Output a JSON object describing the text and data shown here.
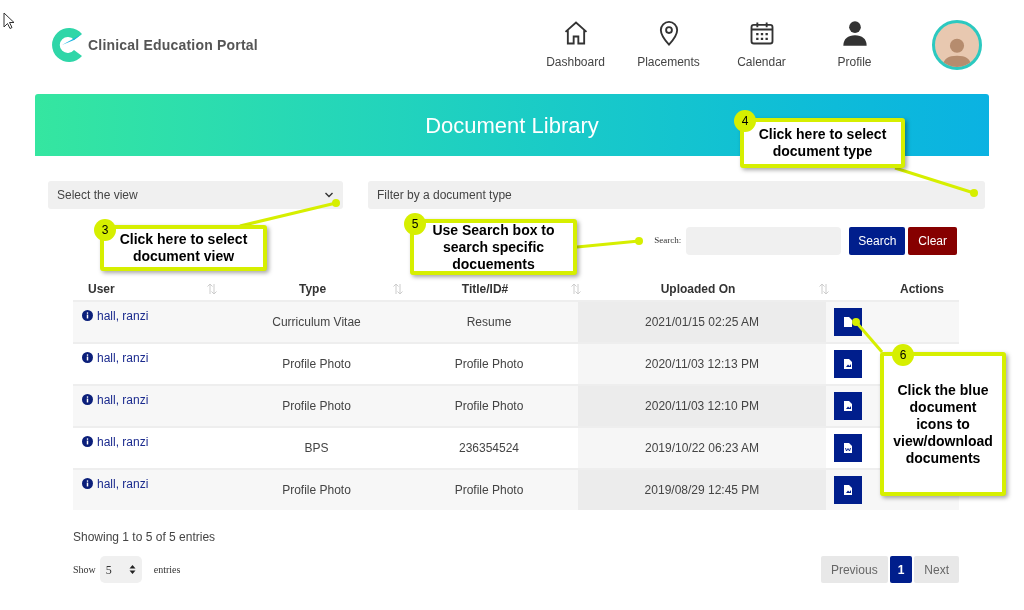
{
  "header": {
    "brand": "Clinical Education Portal",
    "nav": [
      {
        "label": "Dashboard",
        "kind": "home"
      },
      {
        "label": "Placements",
        "kind": "pin"
      },
      {
        "label": "Calendar",
        "kind": "calendar"
      },
      {
        "label": "Profile",
        "kind": "person"
      }
    ]
  },
  "banner": {
    "title": "Document Library"
  },
  "filters": {
    "view_select": {
      "placeholder": "Select the view"
    },
    "type_select": {
      "placeholder": "Filter by a document type"
    }
  },
  "search": {
    "label": "Search:",
    "buttons": [
      "Search",
      "Clear"
    ]
  },
  "table": {
    "columns": [
      {
        "label": "User",
        "sortable": true
      },
      {
        "label": "Type",
        "sortable": true
      },
      {
        "label": "Title/ID#",
        "sortable": true
      },
      {
        "label": "Uploaded On",
        "sortable": true
      },
      {
        "label": "Actions",
        "sortable": false
      }
    ],
    "rows": [
      {
        "user": "hall, ranzi",
        "type": "Curriculum Vitae",
        "title": "Resume",
        "uploaded": "2021/01/15 02:25 AM",
        "kind": "file"
      },
      {
        "user": "hall, ranzi",
        "type": "Profile Photo",
        "title": "Profile Photo",
        "uploaded": "2020/11/03 12:13 PM",
        "kind": "image"
      },
      {
        "user": "hall, ranzi",
        "type": "Profile Photo",
        "title": "Profile Photo",
        "uploaded": "2020/11/03 12:10 PM",
        "kind": "image"
      },
      {
        "user": "hall, ranzi",
        "type": "BPS",
        "title": "236354524",
        "uploaded": "2019/10/22 06:23 AM",
        "kind": "word"
      },
      {
        "user": "hall, ranzi",
        "type": "Profile Photo",
        "title": "Profile Photo",
        "uploaded": "2019/08/29 12:45 PM",
        "kind": "image"
      }
    ]
  },
  "footer": {
    "info": "Showing 1 to 5 of 5 entries",
    "show_label": "Show",
    "page_size": "5",
    "entries_label": "entries",
    "pagination": [
      {
        "label": "Previous",
        "selected": false
      },
      {
        "label": "1",
        "selected": true
      },
      {
        "label": "Next",
        "selected": false
      }
    ]
  },
  "callouts": [
    {
      "number": "3",
      "text": "Click here to select document view"
    },
    {
      "number": "4",
      "text": "Click here to select document type"
    },
    {
      "number": "5",
      "text": "Use Search box to search specific docuements"
    },
    {
      "number": "6",
      "text": "Click the blue document icons to view/download documents"
    }
  ]
}
